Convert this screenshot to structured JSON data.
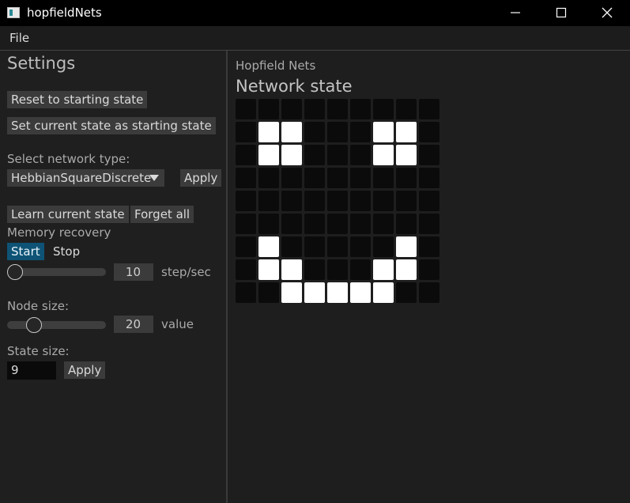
{
  "window": {
    "title": "hopfieldNets"
  },
  "menu": {
    "file": "File"
  },
  "settings": {
    "title": "Settings",
    "reset_button": "Reset to starting state",
    "set_start_button": "Set current state as starting state",
    "network_type_label": "Select network type:",
    "network_type_value": "HebbianSquareDiscrete",
    "network_apply": "Apply",
    "learn_button": "Learn current state",
    "forget_button": "Forget all",
    "memory_label": "Memory recovery",
    "start_button": "Start",
    "stop_button": "Stop",
    "speed_value": "10",
    "speed_unit": "step/sec",
    "speed_level_fraction": 0.0,
    "node_size_label": "Node size:",
    "node_size_value": "20",
    "node_size_unit": "value",
    "node_size_level_fraction": 0.23,
    "state_size_label": "State size:",
    "state_size_value": "9",
    "state_apply": "Apply"
  },
  "main": {
    "app_title": "Hopfield Nets",
    "section_title": "Network state",
    "grid": [
      [
        0,
        0,
        0,
        0,
        0,
        0,
        0,
        0,
        0
      ],
      [
        0,
        1,
        1,
        0,
        0,
        0,
        1,
        1,
        0
      ],
      [
        0,
        1,
        1,
        0,
        0,
        0,
        1,
        1,
        0
      ],
      [
        0,
        0,
        0,
        0,
        0,
        0,
        0,
        0,
        0
      ],
      [
        0,
        0,
        0,
        0,
        0,
        0,
        0,
        0,
        0
      ],
      [
        0,
        0,
        0,
        0,
        0,
        0,
        0,
        0,
        0
      ],
      [
        0,
        1,
        0,
        0,
        0,
        0,
        0,
        1,
        0
      ],
      [
        0,
        1,
        1,
        0,
        0,
        0,
        1,
        1,
        0
      ],
      [
        0,
        0,
        1,
        1,
        1,
        1,
        1,
        0,
        0
      ]
    ]
  },
  "colors": {
    "background": "#1e1e1e",
    "accent": "#0e5375",
    "cell_on": "#ffffff",
    "cell_off": "#0b0b0b"
  }
}
